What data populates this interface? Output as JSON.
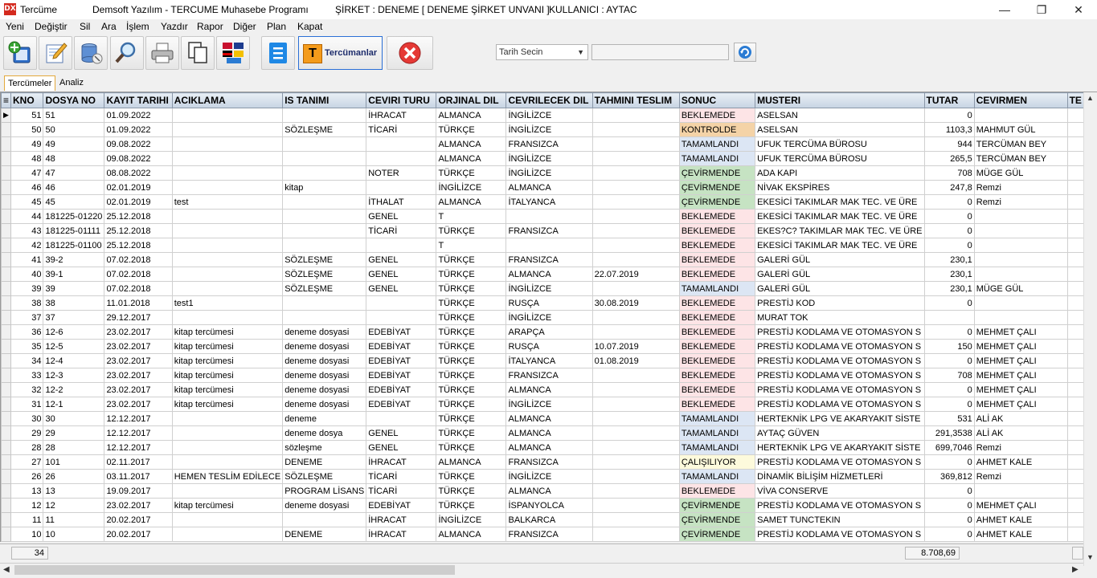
{
  "window": {
    "app_name": "Tercüme",
    "title": "Demsoft Yazılım - TERCUME Muhasebe Programı",
    "company": "ŞİRKET : DENEME [ DENEME ŞİRKET UNVANI ]",
    "user": "KULLANICI : AYTAC",
    "minimize": "—",
    "restore": "❐",
    "close": "✕"
  },
  "menu": [
    "Yeni",
    "Değiştir",
    "Sil",
    "Ara",
    "İşlem",
    "Yazdır",
    "Rapor",
    "Diğer",
    "Plan",
    "Kapat"
  ],
  "toolbar": {
    "translators_label": "Tercümanlar",
    "translators_icon": "T",
    "date_select": "Tarih Secin",
    "date_value": ""
  },
  "tabs": [
    "Tercümeler",
    "Analiz"
  ],
  "grid": {
    "columns": [
      "KNO",
      "DOSYA NO",
      "KAYIT TARIHI",
      "ACIKLAMA",
      "IS TANIMI",
      "CEVIRI TURU",
      "ORJINAL DIL",
      "CEVRILECEK DIL",
      "TAHMINI TESLIM",
      "SONUC",
      "MUSTERI",
      "TUTAR",
      "CEVIRMEN",
      "TE"
    ],
    "rows": [
      [
        "51",
        "51",
        "01.09.2022",
        "",
        "",
        "İHRACAT",
        "ALMANCA",
        "İNGİLİZCE",
        "",
        "BEKLEMEDE",
        "ASELSAN",
        "0",
        ""
      ],
      [
        "50",
        "50",
        "01.09.2022",
        "",
        "SÖZLEŞME",
        "TİCARİ",
        "TÜRKÇE",
        "İNGİLİZCE",
        "",
        "KONTROLDE",
        "ASELSAN",
        "1103,3",
        "MAHMUT GÜL"
      ],
      [
        "49",
        "49",
        "09.08.2022",
        "",
        "",
        "",
        "ALMANCA",
        "FRANSIZCA",
        "",
        "TAMAMLANDI",
        "UFUK TERCÜMA BÜROSU",
        "944",
        "TERCÜMAN BEY"
      ],
      [
        "48",
        "48",
        "09.08.2022",
        "",
        "",
        "",
        "ALMANCA",
        "İNGİLİZCE",
        "",
        "TAMAMLANDI",
        "UFUK TERCÜMA BÜROSU",
        "265,5",
        "TERCÜMAN BEY"
      ],
      [
        "47",
        "47",
        "08.08.2022",
        "",
        "",
        "NOTER",
        "TÜRKÇE",
        "İNGİLİZCE",
        "",
        "ÇEVİRMENDE",
        "ADA KAPI",
        "708",
        "MÜGE GÜL"
      ],
      [
        "46",
        "46",
        "02.01.2019",
        "",
        "kitap",
        "",
        "İNGİLİZCE",
        "ALMANCA",
        "",
        "ÇEVİRMENDE",
        "NİVAK EKSPİRES",
        "247,8",
        "Remzi"
      ],
      [
        "45",
        "45",
        "02.01.2019",
        "test",
        "",
        "İTHALAT",
        "ALMANCA",
        "İTALYANCA",
        "",
        "ÇEVİRMENDE",
        "EKESİCİ TAKIMLAR MAK TEC. VE ÜRE",
        "0",
        "Remzi"
      ],
      [
        "44",
        "181225-01220",
        "25.12.2018",
        "",
        "",
        "GENEL",
        "T",
        "",
        "",
        "BEKLEMEDE",
        "EKESİCİ TAKIMLAR MAK TEC. VE ÜRE",
        "0",
        ""
      ],
      [
        "43",
        "181225-01111",
        "25.12.2018",
        "",
        "",
        "TİCARİ",
        "TÜRKÇE",
        "FRANSIZCA",
        "",
        "BEKLEMEDE",
        "EKES?C? TAKIMLAR MAK TEC. VE ÜRE",
        "0",
        ""
      ],
      [
        "42",
        "181225-01100",
        "25.12.2018",
        "",
        "",
        "",
        "T",
        "",
        "",
        "BEKLEMEDE",
        "EKESİCİ TAKIMLAR MAK TEC. VE ÜRE",
        "0",
        ""
      ],
      [
        "41",
        "39-2",
        "07.02.2018",
        "",
        "SÖZLEŞME",
        "GENEL",
        "TÜRKÇE",
        "FRANSIZCA",
        "",
        "BEKLEMEDE",
        "GALERİ GÜL",
        "230,1",
        ""
      ],
      [
        "40",
        "39-1",
        "07.02.2018",
        "",
        "SÖZLEŞME",
        "GENEL",
        "TÜRKÇE",
        "ALMANCA",
        "22.07.2019",
        "BEKLEMEDE",
        "GALERİ GÜL",
        "230,1",
        ""
      ],
      [
        "39",
        "39",
        "07.02.2018",
        "",
        "SÖZLEŞME",
        "GENEL",
        "TÜRKÇE",
        "İNGİLİZCE",
        "",
        "TAMAMLANDI",
        "GALERİ GÜL",
        "230,1",
        "MÜGE GÜL"
      ],
      [
        "38",
        "38",
        "11.01.2018",
        "test1",
        "",
        "",
        "TÜRKÇE",
        "RUSÇA",
        "30.08.2019",
        "BEKLEMEDE",
        "PRESTİJ KOD",
        "0",
        ""
      ],
      [
        "37",
        "37",
        "29.12.2017",
        "",
        "",
        "",
        "TÜRKÇE",
        "İNGİLİZCE",
        "",
        "BEKLEMEDE",
        "MURAT TOK",
        "",
        ""
      ],
      [
        "36",
        "12-6",
        "23.02.2017",
        "kitap tercümesi",
        "deneme dosyasi",
        "EDEBİYAT",
        "TÜRKÇE",
        "ARAPÇA",
        "",
        "BEKLEMEDE",
        "PRESTİJ KODLAMA VE OTOMASYON S",
        "0",
        "MEHMET ÇALI"
      ],
      [
        "35",
        "12-5",
        "23.02.2017",
        "kitap tercümesi",
        "deneme dosyasi",
        "EDEBİYAT",
        "TÜRKÇE",
        "RUSÇA",
        "10.07.2019",
        "BEKLEMEDE",
        "PRESTİJ KODLAMA VE OTOMASYON S",
        "150",
        "MEHMET ÇALI"
      ],
      [
        "34",
        "12-4",
        "23.02.2017",
        "kitap tercümesi",
        "deneme dosyasi",
        "EDEBİYAT",
        "TÜRKÇE",
        "İTALYANCA",
        "01.08.2019",
        "BEKLEMEDE",
        "PRESTİJ KODLAMA VE OTOMASYON S",
        "0",
        "MEHMET ÇALI"
      ],
      [
        "33",
        "12-3",
        "23.02.2017",
        "kitap tercümesi",
        "deneme dosyasi",
        "EDEBİYAT",
        "TÜRKÇE",
        "FRANSIZCA",
        "",
        "BEKLEMEDE",
        "PRESTİJ KODLAMA VE OTOMASYON S",
        "708",
        "MEHMET ÇALI"
      ],
      [
        "32",
        "12-2",
        "23.02.2017",
        "kitap tercümesi",
        "deneme dosyasi",
        "EDEBİYAT",
        "TÜRKÇE",
        "ALMANCA",
        "",
        "BEKLEMEDE",
        "PRESTİJ KODLAMA VE OTOMASYON S",
        "0",
        "MEHMET ÇALI"
      ],
      [
        "31",
        "12-1",
        "23.02.2017",
        "kitap tercümesi",
        "deneme dosyasi",
        "EDEBİYAT",
        "TÜRKÇE",
        "İNGİLİZCE",
        "",
        "BEKLEMEDE",
        "PRESTİJ KODLAMA VE OTOMASYON S",
        "0",
        "MEHMET ÇALI"
      ],
      [
        "30",
        "30",
        "12.12.2017",
        "",
        "deneme",
        "",
        "TÜRKÇE",
        "ALMANCA",
        "",
        "TAMAMLANDI",
        "HERTEKNİK LPG VE AKARYAKIT SİSTE",
        "531",
        "ALİ AK"
      ],
      [
        "29",
        "29",
        "12.12.2017",
        "",
        "deneme dosya",
        "GENEL",
        "TÜRKÇE",
        "ALMANCA",
        "",
        "TAMAMLANDI",
        "AYTAÇ GÜVEN",
        "291,3538",
        "ALİ AK"
      ],
      [
        "28",
        "28",
        "12.12.2017",
        "",
        "sözleşme",
        "GENEL",
        "TÜRKÇE",
        "ALMANCA",
        "",
        "TAMAMLANDI",
        "HERTEKNİK LPG VE AKARYAKIT SİSTE",
        "699,7046",
        "Remzi"
      ],
      [
        "27",
        "101",
        "02.11.2017",
        "",
        "DENEME",
        "İHRACAT",
        "ALMANCA",
        "FRANSIZCA",
        "",
        "ÇALIŞILIYOR",
        "PRESTİJ KODLAMA VE OTOMASYON S",
        "0",
        "AHMET KALE"
      ],
      [
        "26",
        "26",
        "03.11.2017",
        "HEMEN TESLİM EDİLECE",
        "SÖZLEŞME",
        "TİCARİ",
        "TÜRKÇE",
        "İNGİLİZCE",
        "",
        "TAMAMLANDI",
        "DİNAMİK BİLİŞİM HİZMETLERİ",
        "369,812",
        "Remzi"
      ],
      [
        "13",
        "13",
        "19.09.2017",
        "",
        "PROGRAM LİSANS",
        "TİCARİ",
        "TÜRKÇE",
        "ALMANCA",
        "",
        "BEKLEMEDE",
        "VİVA CONSERVE",
        "0",
        ""
      ],
      [
        "12",
        "12",
        "23.02.2017",
        "kitap tercümesi",
        "deneme dosyasi",
        "EDEBİYAT",
        "TÜRKÇE",
        "İSPANYOLCA",
        "",
        "ÇEVİRMENDE",
        "PRESTİJ KODLAMA VE OTOMASYON S",
        "0",
        "MEHMET ÇALI"
      ],
      [
        "11",
        "11",
        "20.02.2017",
        "",
        "",
        "İHRACAT",
        "İNGİLİZCE",
        "BALKARCA",
        "",
        "ÇEVİRMENDE",
        "SAMET TUNCTEKIN",
        "0",
        "AHMET KALE"
      ],
      [
        "10",
        "10",
        "20.02.2017",
        "",
        "DENEME",
        "İHRACAT",
        "ALMANCA",
        "FRANSIZCA",
        "",
        "ÇEVİRMENDE",
        "PRESTİJ KODLAMA VE OTOMASYON S",
        "0",
        "AHMET KALE"
      ]
    ]
  },
  "footer": {
    "count": "34",
    "total": "8.708,69"
  },
  "colors": {
    "BEKLEMEDE": "#fde4e6",
    "KONTROLDE": "#f4d3a7",
    "TAMAMLANDI": "#dce6f4",
    "ÇEVİRMENDE": "#c6e3c3",
    "ÇALIŞILIYOR": "#fdfadc"
  }
}
